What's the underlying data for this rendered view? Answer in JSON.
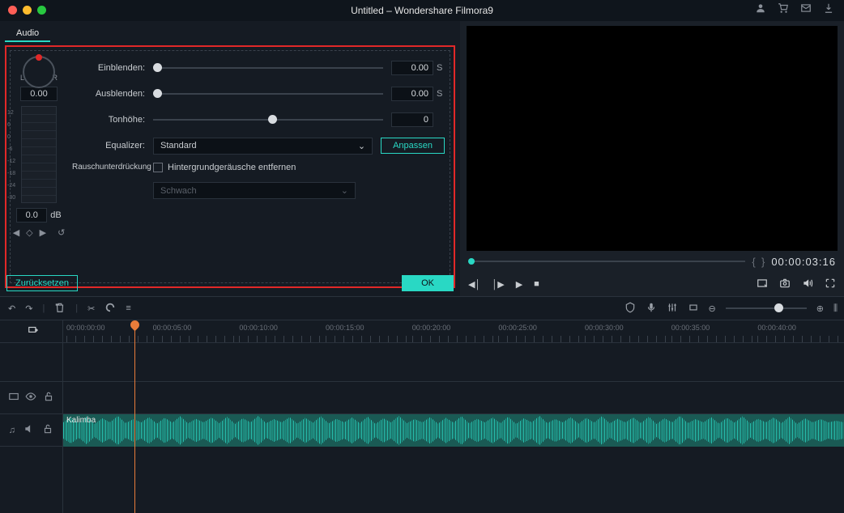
{
  "title": "Untitled – Wondershare Filmora9",
  "topicons": {
    "user": "user-icon",
    "cart": "cart-icon",
    "mail": "mail-icon",
    "download": "download-icon"
  },
  "tab": "Audio",
  "pan": {
    "L": "L",
    "R": "R",
    "value": "0.00"
  },
  "db": {
    "value": "0.0",
    "unit": "dB"
  },
  "rows": {
    "fadein": {
      "label": "Einblenden:",
      "value": "0.00",
      "unit": "S",
      "thumb": 0
    },
    "fadeout": {
      "label": "Ausblenden:",
      "value": "0.00",
      "unit": "S",
      "thumb": 0
    },
    "pitch": {
      "label": "Tonhöhe:",
      "value": "0",
      "unit": "",
      "thumb": 50
    },
    "eq": {
      "label": "Equalizer:",
      "value": "Standard",
      "btn": "Anpassen"
    },
    "noise": {
      "label": "Rauschunterdrückung",
      "chk": "Hintergrundgeräusche entfernen",
      "strength": "Schwach"
    }
  },
  "reset": "Zurücksetzen",
  "ok": "OK",
  "timecode": "00:00:03:16",
  "ruler": [
    "00:00:00:00",
    "00:00:05:00",
    "00:00:10:00",
    "00:00:15:00",
    "00:00:20:00",
    "00:00:25:00",
    "00:00:30:00",
    "00:00:35:00",
    "00:00:40:00"
  ],
  "clip": "Kalimba"
}
